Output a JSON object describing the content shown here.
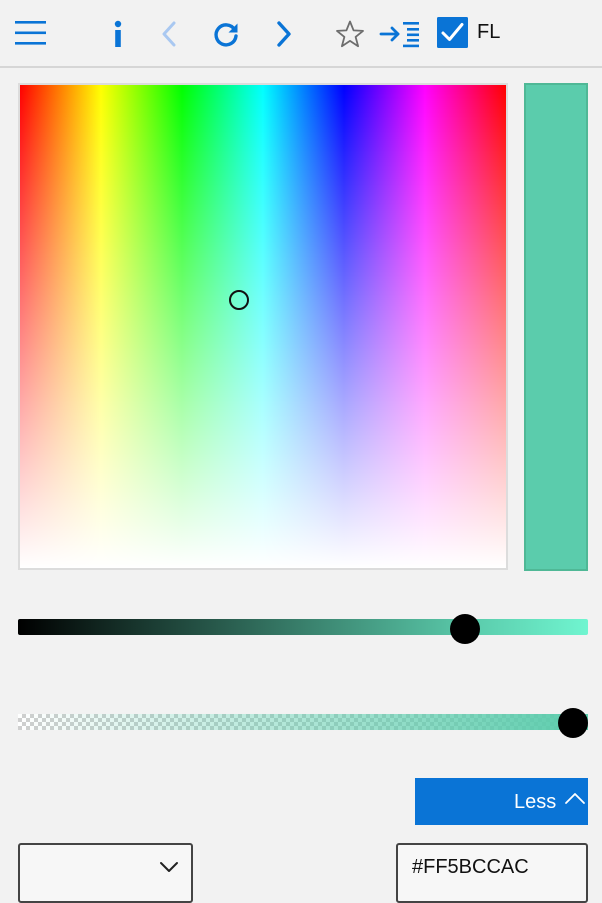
{
  "toolbar": {
    "fl_label": "FL",
    "fl_checked": true,
    "icons": {
      "menu": "hamburger-menu-icon",
      "info": "info-icon",
      "back": "chevron-left-icon",
      "refresh": "refresh-icon",
      "forward": "chevron-right-icon",
      "favorite": "star-icon",
      "indent": "indent-icon",
      "fl_check": "checkbox-checked-icon"
    },
    "colors": {
      "accent": "#0a74d6",
      "disabled": "#a9c8f1",
      "star": "#6d6d6d"
    }
  },
  "picker": {
    "selected_color": "#5BCCAC",
    "value_slider": {
      "fraction": 0.8,
      "end_color": "#70f5d0"
    },
    "alpha_slider": {
      "fraction": 1.0,
      "color": "#5BCCAC"
    },
    "less_label": "Less",
    "mode_select_value": "",
    "hex_value": "#FF5BCCAC"
  }
}
